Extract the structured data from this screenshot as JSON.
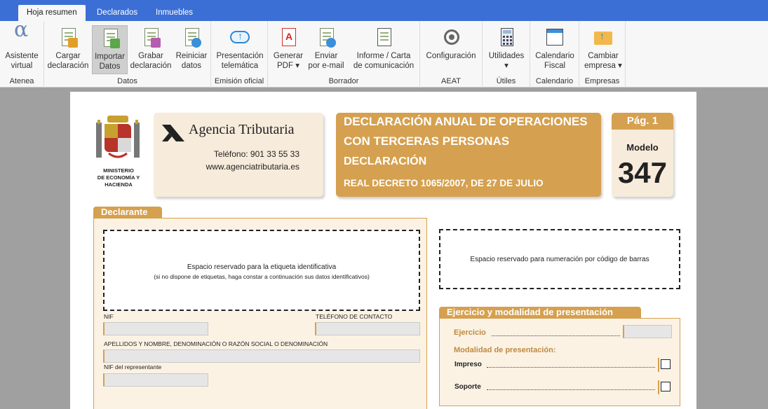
{
  "tabs": [
    "Hoja resumen",
    "Declarados",
    "Inmuebles"
  ],
  "ribbon": {
    "groups": {
      "atenea": "Atenea",
      "datos": "Datos",
      "emision": "Emisión oficial",
      "borrador": "Borrador",
      "aeat": "AEAT",
      "utiles": "Útiles",
      "calendario": "Calendario",
      "empresas": "Empresas"
    },
    "buttons": {
      "asistente": "Asistente\nvirtual",
      "cargar": "Cargar\ndeclaración",
      "importar": "Importar\nDatos",
      "grabar": "Grabar\ndeclaración",
      "reiniciar": "Reiniciar\ndatos",
      "presentacion": "Presentación\ntelemática",
      "pdf": "Generar\nPDF ▾",
      "email": "Enviar\npor e-mail",
      "informe": "Informe / Carta\nde comunicación",
      "configuracion": "Configuración",
      "utilidades": "Utilidades\n▾",
      "calendario": "Calendario\nFiscal",
      "empresa": "Cambiar\nempresa ▾"
    }
  },
  "form": {
    "ministry": "MINISTERIO\nDE ECONOMÍA Y\nHACIENDA",
    "agency_name": "Agencia Tributaria",
    "agency_phone": "Teléfono: 901 33 55 33",
    "agency_web": "www.agenciatributaria.es",
    "title_line1": "DECLARACIÓN ANUAL DE OPERACIONES",
    "title_line2": "CON TERCERAS PERSONAS",
    "title_line3": "DECLARACIÓN",
    "title_line4": "REAL DECRETO 1065/2007, DE 27 DE JULIO",
    "page_label": "Pág. 1",
    "modelo_label": "Modelo",
    "modelo_number": "347",
    "declarante_tab": "Declarante",
    "label_space_line1": "Espacio reservado para la etiqueta identificativa",
    "label_space_line2": "(si no dispone de etiquetas, haga constar a continuación sus datos identificativos)",
    "barcode_space": "Espacio reservado para numeración por código de barras",
    "nif_label": "NIF",
    "telefono_label": "TELÉFONO DE CONTACTO",
    "apellidos_label": "APELLIDOS Y NOMBRE, DENOMINACIÓN O RAZÓN SOCIAL O DENOMINACIÓN",
    "nif_rep_label": "NIF del representante",
    "ejercicio_tab": "Ejercicio y modalidad de presentación",
    "ejercicio_label": "Ejercicio",
    "modalidad_label": "Modalidad de presentación:",
    "impreso_label": "Impreso",
    "soporte_label": "Soporte"
  },
  "colors": {
    "tabbar": "#3b6fd6",
    "accent": "#d5a04f",
    "panel_bg": "#fbf2e4"
  }
}
